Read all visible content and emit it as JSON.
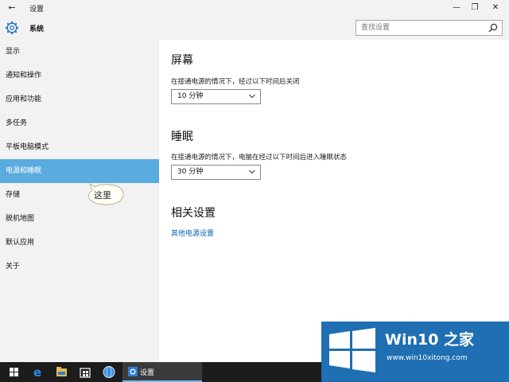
{
  "window": {
    "title": "设置",
    "back_glyph": "←",
    "minimize_glyph": "—",
    "maximize_glyph": "❐",
    "close_glyph": "✕"
  },
  "header": {
    "section_title": "系统",
    "icon": "gear-icon"
  },
  "search": {
    "placeholder": "查找设置",
    "icon": "search-icon"
  },
  "sidebar": {
    "items": [
      {
        "label": "显示"
      },
      {
        "label": "通知和操作"
      },
      {
        "label": "应用和功能"
      },
      {
        "label": "多任务"
      },
      {
        "label": "平板电脑模式"
      },
      {
        "label": "电源和睡眠",
        "active": true
      },
      {
        "label": "存储"
      },
      {
        "label": "脱机地图"
      },
      {
        "label": "默认应用"
      },
      {
        "label": "关于"
      }
    ],
    "callout": "这里"
  },
  "main": {
    "screen": {
      "heading": "屏幕",
      "description": "在接通电源的情况下，经过以下时间后关闭",
      "value": "10 分钟"
    },
    "sleep": {
      "heading": "睡眠",
      "description": "在接通电源的情况下，电脑在经过以下时间后进入睡眠状态",
      "value": "30 分钟"
    },
    "related": {
      "heading": "相关设置",
      "link": "其他电源设置"
    }
  },
  "taskbar": {
    "active_app_label": "设置",
    "icons": [
      "windows-start-icon",
      "edge-icon",
      "file-explorer-icon",
      "store-icon",
      "globe-icon",
      "settings-icon"
    ]
  },
  "watermark": {
    "title": "Win10 之家",
    "url": "www.win10xitong.com"
  },
  "colors": {
    "accent": "#5aabe0",
    "link": "#0063b1",
    "sidebar_bg": "#f2f2f2",
    "taskbar_bg": "#1c1c1c",
    "watermark_bg": "#1f6fb2"
  }
}
